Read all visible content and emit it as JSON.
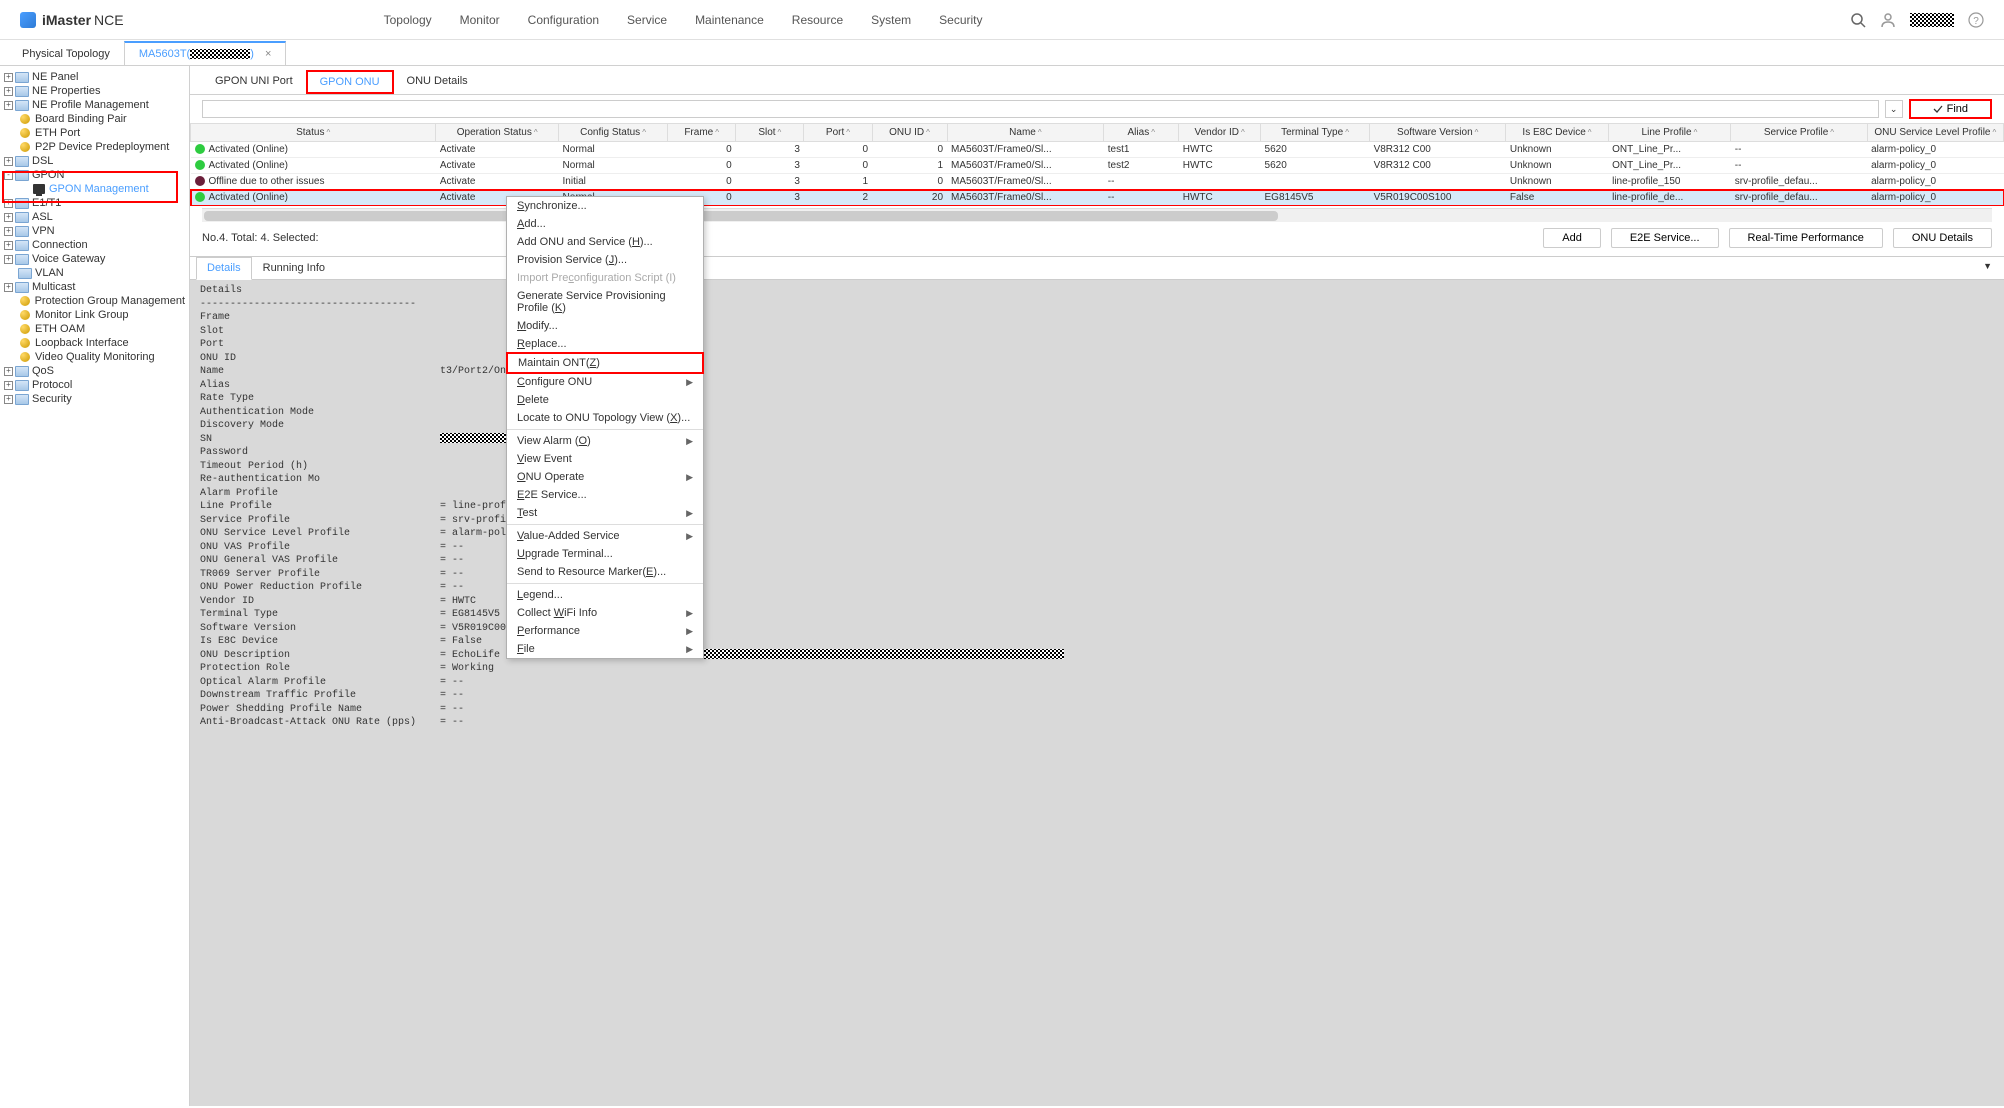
{
  "header": {
    "logo_main": "iMaster",
    "logo_sub": "NCE",
    "nav": [
      "Topology",
      "Monitor",
      "Configuration",
      "Service",
      "Maintenance",
      "Resource",
      "System",
      "Security"
    ]
  },
  "top_tabs": {
    "plain": "Physical Topology",
    "active_prefix": "MA5603T(",
    "active_suffix": ")"
  },
  "sidebar": {
    "items": [
      {
        "type": "folder",
        "toggle": "+",
        "label": "NE Panel",
        "indent": 0
      },
      {
        "type": "folder",
        "toggle": "+",
        "label": "NE Properties",
        "indent": 0
      },
      {
        "type": "folder",
        "toggle": "+",
        "label": "NE Profile Management",
        "indent": 0
      },
      {
        "type": "orb",
        "toggle": "",
        "label": "Board Binding Pair",
        "indent": 1
      },
      {
        "type": "orb",
        "toggle": "",
        "label": "ETH Port",
        "indent": 1
      },
      {
        "type": "orb",
        "toggle": "",
        "label": "P2P Device Predeployment",
        "indent": 1
      },
      {
        "type": "folder",
        "toggle": "+",
        "label": "DSL",
        "indent": 0
      },
      {
        "type": "folder",
        "toggle": "-",
        "label": "GPON",
        "indent": 0
      },
      {
        "type": "monitor",
        "toggle": "",
        "label": "GPON Management",
        "indent": 2,
        "active": true
      },
      {
        "type": "folder",
        "toggle": "+",
        "label": "E1/T1",
        "indent": 0
      },
      {
        "type": "folder",
        "toggle": "+",
        "label": "ASL",
        "indent": 0
      },
      {
        "type": "folder",
        "toggle": "+",
        "label": "VPN",
        "indent": 0
      },
      {
        "type": "folder",
        "toggle": "+",
        "label": "Connection",
        "indent": 0
      },
      {
        "type": "folder",
        "toggle": "+",
        "label": "Voice Gateway",
        "indent": 0
      },
      {
        "type": "folder",
        "toggle": "",
        "label": "VLAN",
        "indent": 1
      },
      {
        "type": "folder",
        "toggle": "+",
        "label": "Multicast",
        "indent": 0
      },
      {
        "type": "orb",
        "toggle": "",
        "label": "Protection Group Management",
        "indent": 1
      },
      {
        "type": "orb",
        "toggle": "",
        "label": "Monitor Link Group",
        "indent": 1
      },
      {
        "type": "orb",
        "toggle": "",
        "label": "ETH OAM",
        "indent": 1
      },
      {
        "type": "orb",
        "toggle": "",
        "label": "Loopback Interface",
        "indent": 1
      },
      {
        "type": "orb",
        "toggle": "",
        "label": "Video Quality Monitoring",
        "indent": 1
      },
      {
        "type": "folder",
        "toggle": "+",
        "label": "QoS",
        "indent": 0
      },
      {
        "type": "folder",
        "toggle": "+",
        "label": "Protocol",
        "indent": 0
      },
      {
        "type": "folder",
        "toggle": "+",
        "label": "Security",
        "indent": 0
      }
    ]
  },
  "sub_tabs": [
    "GPON UNI Port",
    "GPON ONU",
    "ONU Details"
  ],
  "search": {
    "placeholder": "",
    "find_label": "Find"
  },
  "table": {
    "columns": [
      "Status",
      "Operation Status",
      "Config Status",
      "Frame",
      "Slot",
      "Port",
      "ONU ID",
      "Name",
      "Alias",
      "Vendor ID",
      "Terminal Type",
      "Software Version",
      "Is E8C Device",
      "Line Profile",
      "Service Profile",
      "ONU Service Level Profile"
    ],
    "rows": [
      {
        "dot": "green",
        "status": "Activated (Online)",
        "op": "Activate",
        "cfg": "Normal",
        "frame": "0",
        "slot": "3",
        "port": "0",
        "onuid": "0",
        "name": "MA5603T/Frame0/Sl...",
        "alias": "test1",
        "vendor": "HWTC",
        "ttype": "5620",
        "swver": "V8R312 C00",
        "e8c": "Unknown",
        "line": "ONT_Line_Pr...",
        "svc": "--",
        "slp": "alarm-policy_0"
      },
      {
        "dot": "green",
        "status": "Activated (Online)",
        "op": "Activate",
        "cfg": "Normal",
        "frame": "0",
        "slot": "3",
        "port": "0",
        "onuid": "1",
        "name": "MA5603T/Frame0/Sl...",
        "alias": "test2",
        "vendor": "HWTC",
        "ttype": "5620",
        "swver": "V8R312 C00",
        "e8c": "Unknown",
        "line": "ONT_Line_Pr...",
        "svc": "--",
        "slp": "alarm-policy_0"
      },
      {
        "dot": "darkred",
        "status": "Offline due to other issues",
        "op": "Activate",
        "cfg": "Initial",
        "frame": "0",
        "slot": "3",
        "port": "1",
        "onuid": "0",
        "name": "MA5603T/Frame0/Sl...",
        "alias": "--",
        "vendor": "",
        "ttype": "",
        "swver": "",
        "e8c": "Unknown",
        "line": "line-profile_150",
        "svc": "srv-profile_defau...",
        "slp": "alarm-policy_0"
      },
      {
        "dot": "green",
        "status": "Activated (Online)",
        "op": "Activate",
        "cfg": "Normal",
        "frame": "0",
        "slot": "3",
        "port": "2",
        "onuid": "20",
        "name": "MA5603T/Frame0/Sl...",
        "alias": "--",
        "vendor": "HWTC",
        "ttype": "EG8145V5",
        "swver": "V5R019C00S100",
        "e8c": "False",
        "line": "line-profile_de...",
        "svc": "srv-profile_defau...",
        "slp": "alarm-policy_0",
        "selected": true
      }
    ]
  },
  "status_bar": {
    "text": "No.4. Total: 4. Selected:",
    "buttons": [
      "Add",
      "E2E Service...",
      "Real-Time Performance",
      "ONU Details"
    ]
  },
  "detail_tabs": {
    "active": "Details",
    "other": "Running Info"
  },
  "details_text": {
    "title": "Details",
    "lines": [
      "Frame",
      "Slot",
      "Port",
      "ONU ID",
      {
        "label": "Name",
        "value": "t3/Port2/OnuID20"
      },
      "Alias",
      "Rate Type",
      "Authentication Mode",
      "Discovery Mode",
      {
        "label": "SN",
        "redacted": true
      },
      "Password",
      "Timeout Period (h)",
      "Re-authentication Mo",
      "Alarm Profile",
      {
        "label": "Line Profile",
        "value": "= line-profile_default_0"
      },
      {
        "label": "Service Profile",
        "value": "= srv-profile_default_0"
      },
      {
        "label": "ONU Service Level Profile",
        "value": "= alarm-policy_0"
      },
      {
        "label": "ONU VAS Profile",
        "value": "= --"
      },
      {
        "label": "ONU General VAS Profile",
        "value": "= --"
      },
      {
        "label": "TR069 Server Profile",
        "value": "= --"
      },
      {
        "label": "ONU Power Reduction Profile",
        "value": "= --"
      },
      {
        "label": "Vendor ID",
        "value": "= HWTC"
      },
      {
        "label": "Terminal Type",
        "value": "= EG8145V5"
      },
      {
        "label": "Software Version",
        "value": "= V5R019C00S100"
      },
      {
        "label": "Is E8C Device",
        "value": "= False"
      },
      {
        "label": "ONU Description",
        "value": "= EchoLife EG8145V5 GPON Terminal",
        "redacted_after": true
      },
      {
        "label": "Protection Role",
        "value": "= Working"
      },
      {
        "label": "Optical Alarm Profile",
        "value": "= --"
      },
      {
        "label": "Downstream Traffic Profile",
        "value": "= --"
      },
      {
        "label": "Power Shedding Profile Name",
        "value": "= --"
      },
      {
        "label": "Anti-Broadcast-Attack ONU Rate (pps)",
        "value": "= --"
      }
    ]
  },
  "context_menu": {
    "items": [
      {
        "label": "Synchronize...",
        "u": "S"
      },
      {
        "label": "Add...",
        "u": "A"
      },
      {
        "label": "Add ONU and Service (H)...",
        "plain": true,
        "u": "H"
      },
      {
        "label": "Provision Service (J)...",
        "plain": true,
        "u": "J"
      },
      {
        "label": "Import Preconfiguration Script (I)",
        "disabled": true,
        "u": "c"
      },
      {
        "label": "Generate Service Provisioning Profile (K)",
        "plain": true,
        "u": "K"
      },
      {
        "label": "Modify...",
        "u": "M"
      },
      {
        "label": "Replace...",
        "u": "R"
      },
      {
        "label": "Maintain ONT(Z)",
        "highlighted": true,
        "u": "Z",
        "plain": true
      },
      {
        "label": "Configure ONU",
        "sub": true,
        "u": "C"
      },
      {
        "label": "Delete",
        "u": "D"
      },
      {
        "label": "Locate to ONU Topology View (X)...",
        "plain": true,
        "u": "X"
      },
      {
        "sep": true
      },
      {
        "label": "View Alarm (O)",
        "sub": true,
        "plain": true,
        "u": "O"
      },
      {
        "label": "View Event",
        "u": "V"
      },
      {
        "label": "ONU Operate",
        "sub": true,
        "u": "O"
      },
      {
        "label": "E2E Service...",
        "u": "E"
      },
      {
        "label": "Test",
        "sub": true,
        "u": "T"
      },
      {
        "sep": true
      },
      {
        "label": "Value-Added Service",
        "sub": true,
        "u": "V"
      },
      {
        "label": "Upgrade Terminal...",
        "u": "U"
      },
      {
        "label": "Send to Resource Marker(E)...",
        "plain": true,
        "u": "E"
      },
      {
        "sep": true
      },
      {
        "label": "Legend...",
        "u": "L"
      },
      {
        "label": "Collect WiFi Info",
        "sub": true,
        "u": "W"
      },
      {
        "label": "Performance",
        "sub": true,
        "u": "P"
      },
      {
        "label": "File",
        "sub": true,
        "u": "F"
      }
    ]
  }
}
